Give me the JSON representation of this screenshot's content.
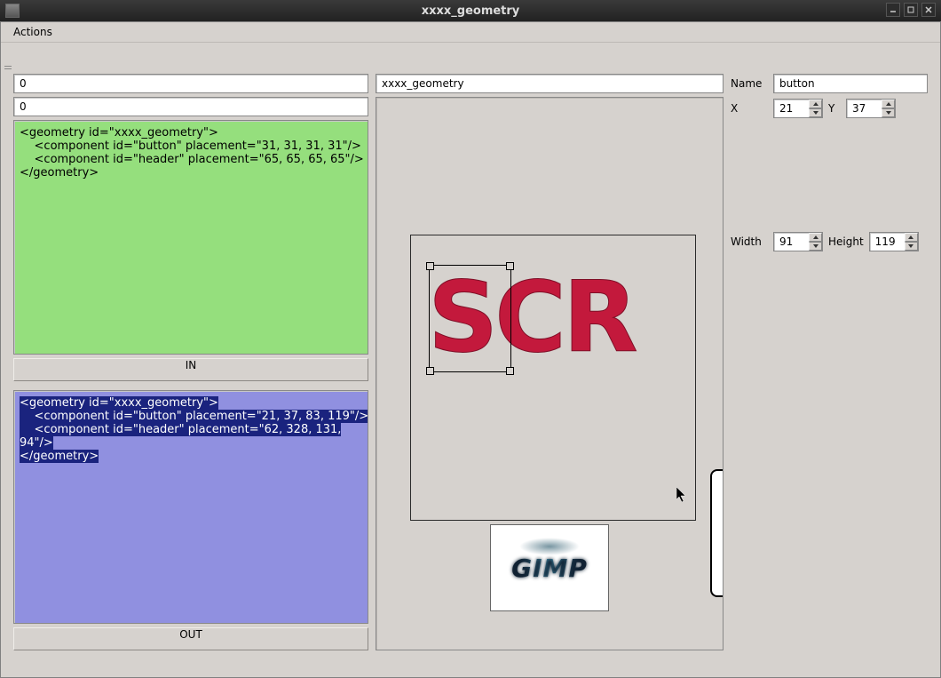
{
  "window": {
    "title": "xxxx_geometry"
  },
  "menubar": {
    "actions": "Actions"
  },
  "left": {
    "input_top": "0",
    "input_second": "0",
    "text_in": "<geometry id=\"xxxx_geometry\">\n    <component id=\"button\" placement=\"31, 31, 31, 31\"/>\n    <component id=\"header\" placement=\"65, 65, 65, 65\"/>\n</geometry>",
    "btn_in": "IN",
    "text_out_lines": [
      "<geometry id=\"xxxx_geometry\">",
      "    <component id=\"button\" placement=\"21, 37, 83, 119\"/>",
      "    <component id=\"header\" placement=\"62, 328, 131,",
      "94\"/>",
      "</geometry>"
    ],
    "btn_out": "OUT"
  },
  "mid": {
    "title_input": "xxxx_geometry",
    "scr_text": "SCR",
    "thumb_text": "GIMP"
  },
  "right": {
    "name_label": "Name",
    "name_value": "button",
    "x_label": "X",
    "x_value": "21",
    "y_label": "Y",
    "y_value": "37",
    "width_label": "Width",
    "width_value": "91",
    "height_label": "Height",
    "height_value": "119"
  }
}
